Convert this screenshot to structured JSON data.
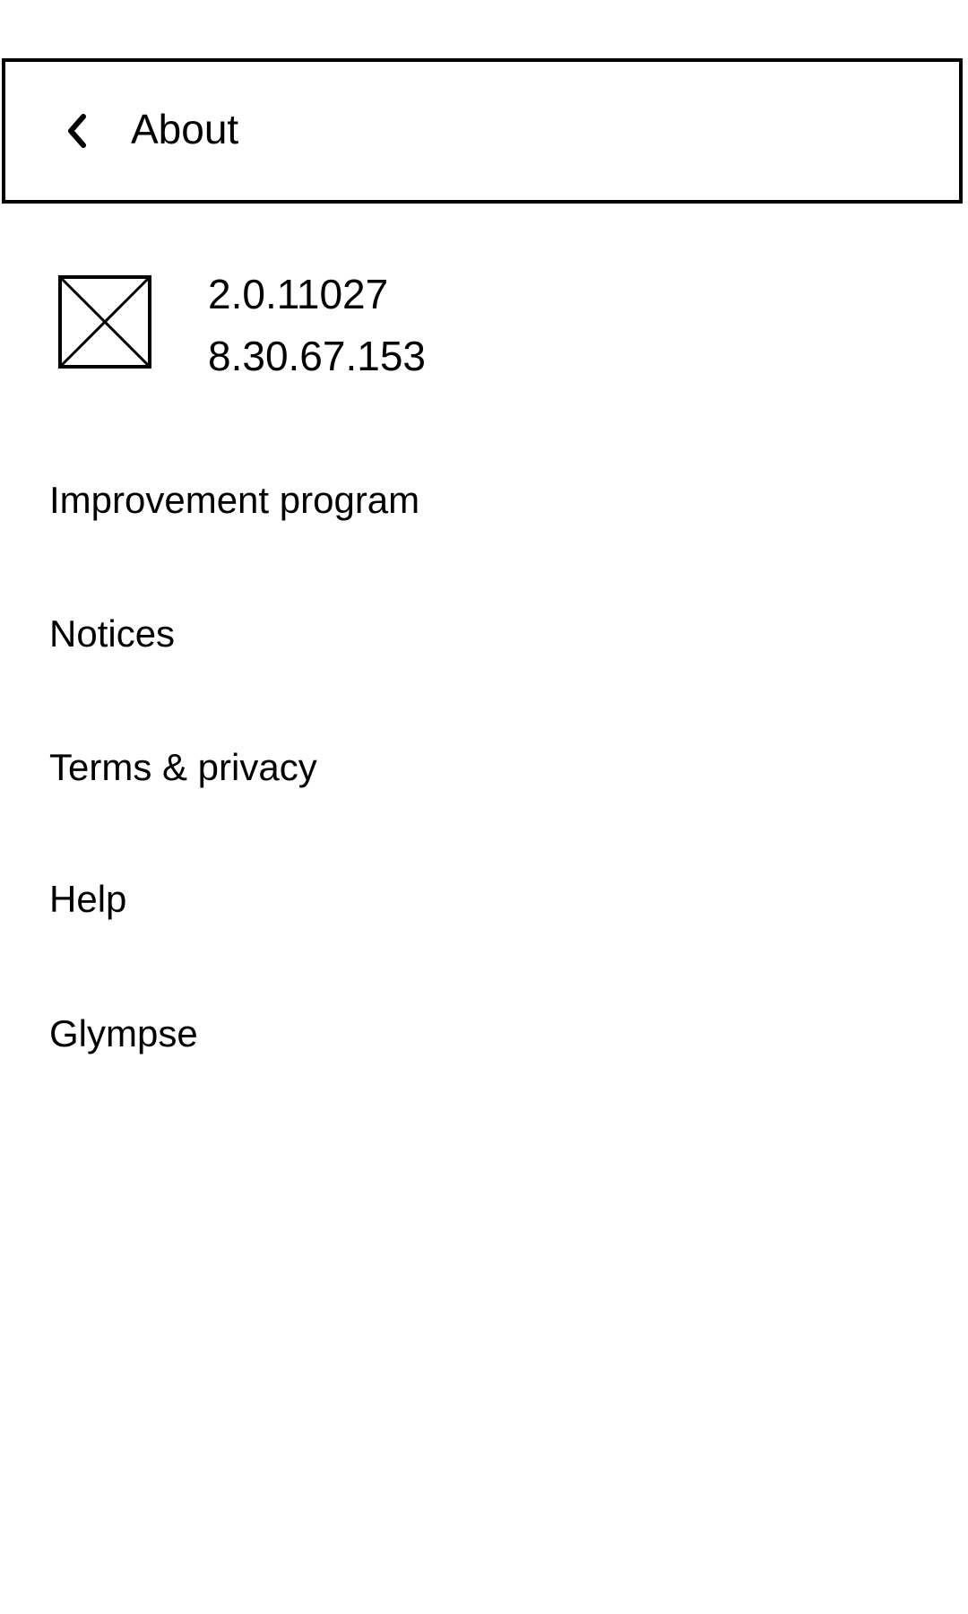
{
  "header": {
    "title": "About",
    "back_icon": "chevron-left-icon"
  },
  "app_info": {
    "icon": "image-placeholder-icon",
    "version": "2.0.11027",
    "build": "8.30.67.153"
  },
  "menu": {
    "items": [
      {
        "label": "Improvement program"
      },
      {
        "label": "Notices"
      },
      {
        "label": "Terms & privacy"
      },
      {
        "label": "Help"
      },
      {
        "label": "Glympse"
      }
    ]
  }
}
